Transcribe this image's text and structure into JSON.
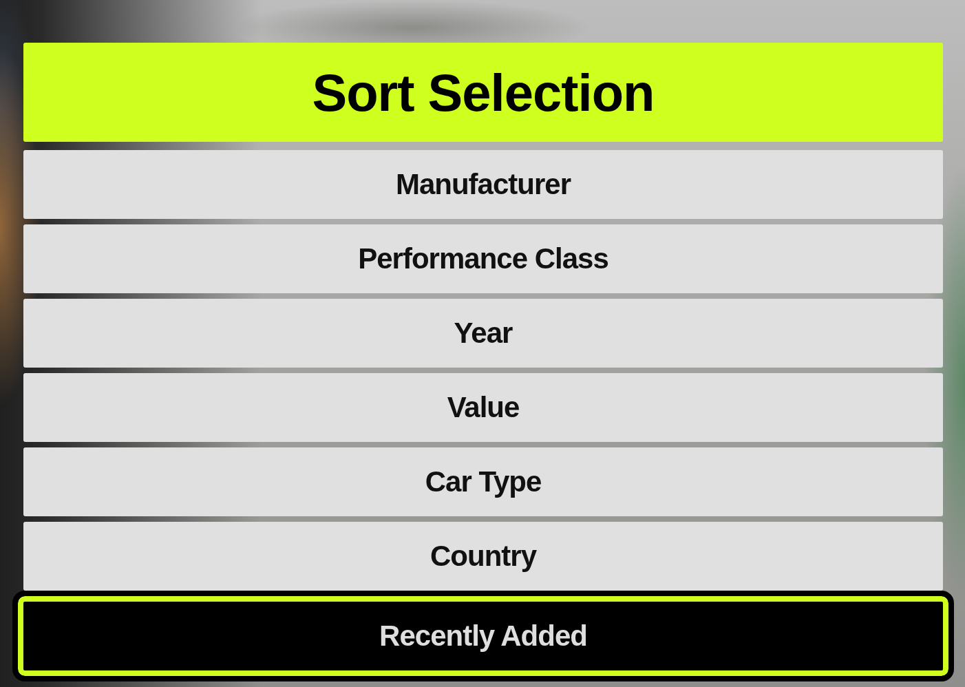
{
  "title": "Sort Selection",
  "options": [
    {
      "label": "Manufacturer",
      "selected": false
    },
    {
      "label": "Performance Class",
      "selected": false
    },
    {
      "label": "Year",
      "selected": false
    },
    {
      "label": "Value",
      "selected": false
    },
    {
      "label": "Car Type",
      "selected": false
    },
    {
      "label": "Country",
      "selected": false
    },
    {
      "label": "Recently Added",
      "selected": true
    }
  ]
}
